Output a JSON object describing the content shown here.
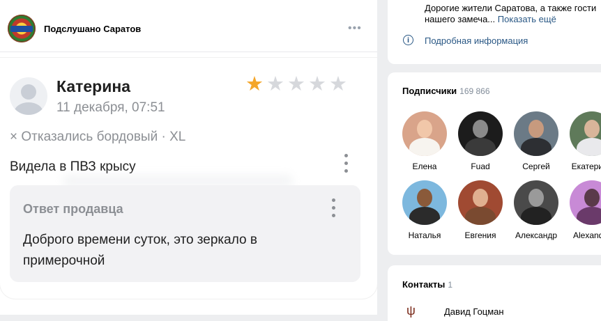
{
  "post": {
    "group_name": "Подслушано Саратов",
    "menu_glyph": "•••",
    "review": {
      "author": "Катерина",
      "date": "11 декабря, 07:51",
      "rating": 1,
      "rating_max": 5,
      "meta": "× Отказались  бордовый · XL",
      "text": "Видела в ПВЗ крысу",
      "seller_answer": {
        "title": "Ответ продавца",
        "text": "Доброго времени суток, это зеркало в примерочной"
      }
    }
  },
  "sidebar": {
    "description": "Дорогие жители Саратова, а также гости нашего замеча...",
    "show_more": "Показать ещё",
    "details_link": "Подробная информация",
    "subscribers": {
      "title": "Подписчики",
      "count": "169 866",
      "people": [
        {
          "name": "Елена"
        },
        {
          "name": "Fuad"
        },
        {
          "name": "Сергей"
        },
        {
          "name": "Екатерина"
        },
        {
          "name": "Наталья"
        },
        {
          "name": "Евгения"
        },
        {
          "name": "Александр"
        },
        {
          "name": "Alexander"
        }
      ]
    },
    "contacts": {
      "title": "Контакты",
      "count": "1",
      "items": [
        {
          "name": "Давид Гоцман"
        }
      ]
    }
  },
  "colors": {
    "link": "#2a5885",
    "star_active": "#f4a62a",
    "star_inactive": "#d6d8dc",
    "page_bg": "#edeef0"
  }
}
